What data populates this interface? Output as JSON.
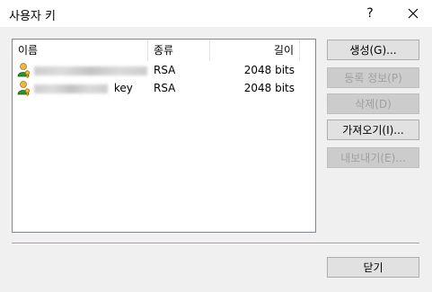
{
  "dialog": {
    "title": "사용자 키",
    "help_label": "?"
  },
  "list": {
    "columns": [
      {
        "label": "이름"
      },
      {
        "label": "종류"
      },
      {
        "label": "길이"
      }
    ],
    "rows": [
      {
        "name_suffix": "",
        "type": "RSA",
        "length": "2048 bits",
        "icon": "user-key-icon"
      },
      {
        "name_suffix": "key",
        "type": "RSA",
        "length": "2048 bits",
        "icon": "user-key-icon"
      }
    ]
  },
  "buttons": {
    "generate": "생성(G)...",
    "register_info": "등록 정보(P)",
    "delete": "삭제(D)",
    "import": "가져오기(I)...",
    "export": "내보내기(E)...",
    "close": "닫기"
  },
  "colors": {
    "window_bg": "#f0f0f0",
    "titlebar_bg": "#ffffff",
    "button_bg": "#e1e1e1",
    "disabled_text": "#a0a0a0"
  }
}
